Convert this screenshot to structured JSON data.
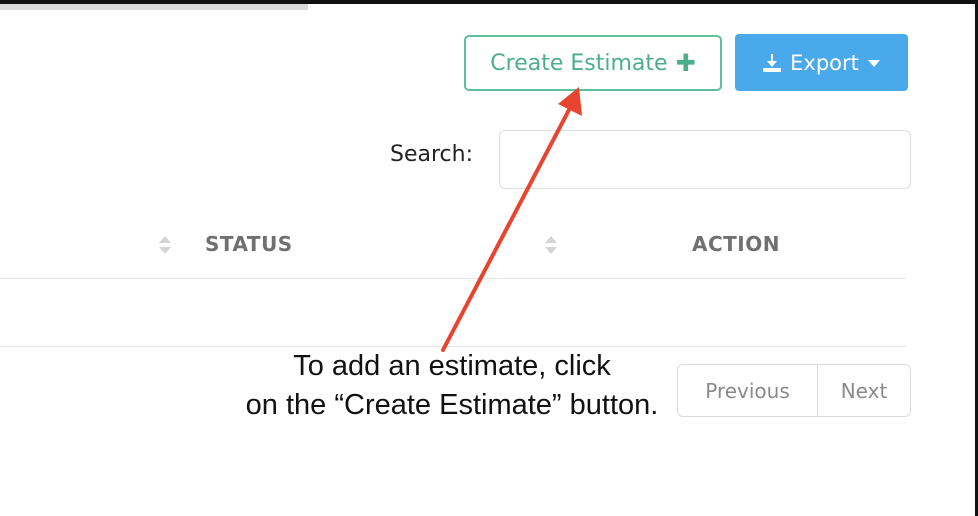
{
  "toolbar": {
    "create_label": "Create Estimate",
    "create_icon": "plus-icon",
    "export_label": "Export",
    "export_icon": "download-icon",
    "export_caret_icon": "caret-down-icon"
  },
  "search": {
    "label": "Search:",
    "value": "",
    "placeholder": ""
  },
  "table": {
    "headers": [
      "STATUS",
      "ACTION"
    ]
  },
  "pagination": {
    "previous": "Previous",
    "next": "Next"
  },
  "annotation": {
    "line1": "To add an estimate, click",
    "line2": "on the “Create Estimate” button."
  },
  "colors": {
    "create_accent": "#4caf8a",
    "export_bg": "#4aa9ea",
    "arrow": "#e8442f"
  }
}
